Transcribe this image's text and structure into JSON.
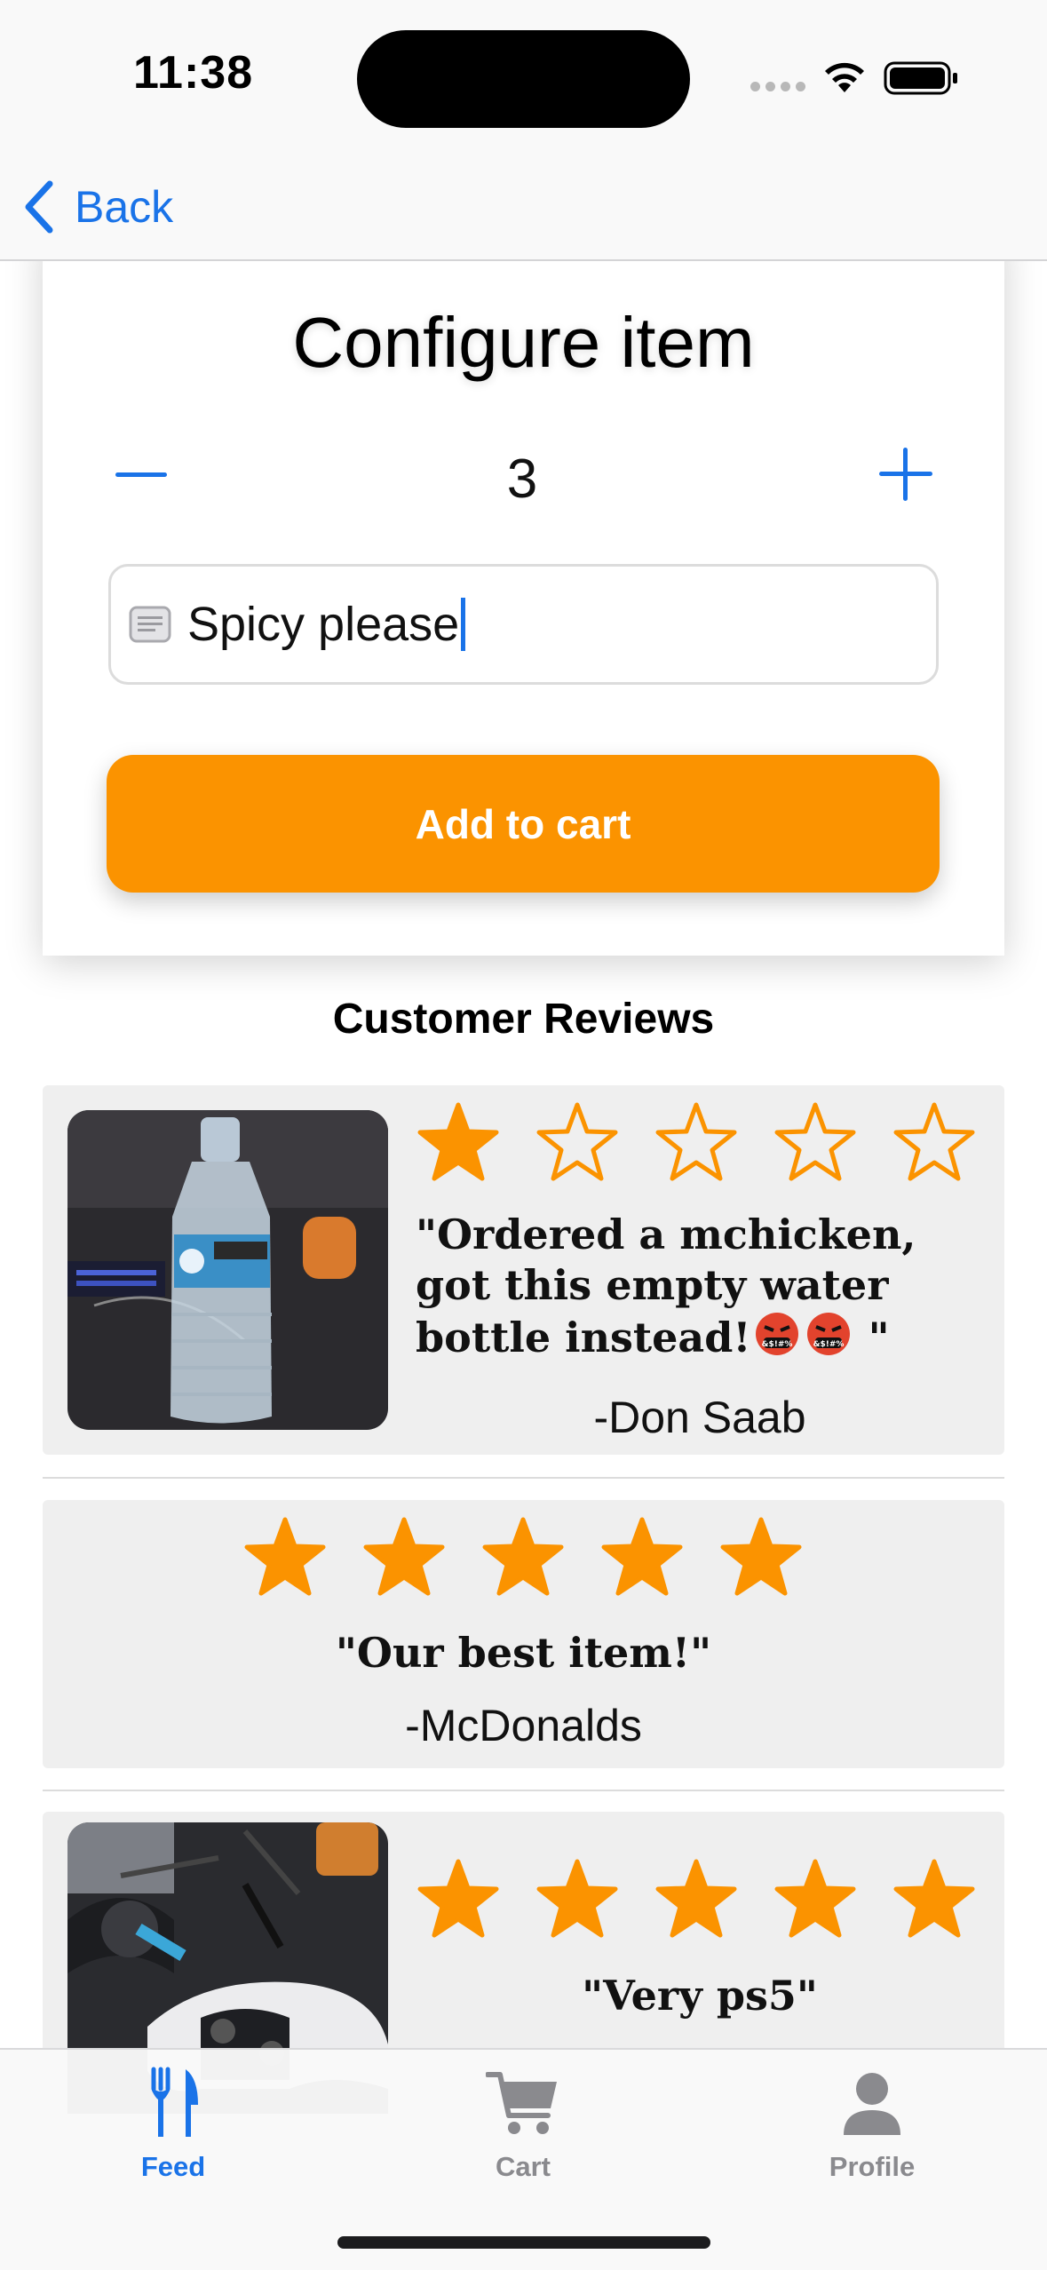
{
  "status_bar": {
    "time": "11:38"
  },
  "nav": {
    "back_label": "Back"
  },
  "config": {
    "title": "Configure item",
    "quantity": "3",
    "notes_value": "Spicy please",
    "add_to_cart_label": "Add to cart"
  },
  "reviews": {
    "heading": "Customer Reviews",
    "items": [
      {
        "rating": 1,
        "max_rating": 5,
        "quote": "\"Ordered a mchicken, got this empty water bottle instead!",
        "quote_end": " \"",
        "author": "-Don Saab",
        "photo": "water-bottle-photo"
      },
      {
        "rating": 5,
        "max_rating": 5,
        "quote": "\"Our best item!\"",
        "author": "-McDonalds",
        "photo": ""
      },
      {
        "rating": 5,
        "max_rating": 5,
        "quote": "\"Very ps5\"",
        "author": "",
        "photo": "ps5-controller-photo"
      }
    ]
  },
  "tabs": [
    {
      "label": "Feed",
      "icon": "fork-knife-icon",
      "active": true
    },
    {
      "label": "Cart",
      "icon": "cart-icon",
      "active": false
    },
    {
      "label": "Profile",
      "icon": "person-icon",
      "active": false
    }
  ],
  "colors": {
    "accent": "#1a73e8",
    "star": "#fb9300",
    "button": "#fb9300",
    "card": "#efefef",
    "inactive": "#8a8a8e"
  }
}
